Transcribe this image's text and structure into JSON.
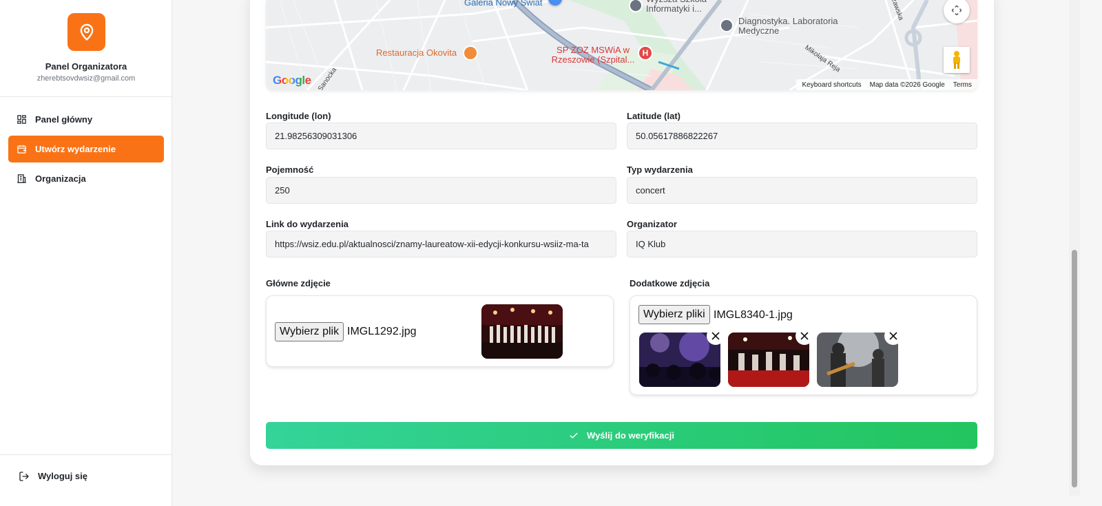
{
  "sidebar": {
    "title": "Panel Organizatora",
    "email": "zherebtsovdwsiz@gmail.com",
    "items": [
      {
        "label": "Panel główny"
      },
      {
        "label": "Utwórz wydarzenie"
      },
      {
        "label": "Organizacja"
      }
    ],
    "logout": "Wyloguj się",
    "accent": "#f97316"
  },
  "map": {
    "labels": {
      "galeria": "Galeria Nowy Świat",
      "szkola": "Wyższa Szkoła Informatyki i...",
      "diagnostyka": "Diagnostyka. Laboratoria Medyczne",
      "restauracja": "Restauracja Okovita",
      "szpital": "SP ZOZ MSWiA w Rzeszowie (Szpital...",
      "sanocka": "Sanocka",
      "mikolaja": "Mikołaja Reja",
      "zawska": "zawska"
    },
    "footer": {
      "shortcuts": "Keyboard shortcuts",
      "map_data": "Map data ©2026 Google",
      "terms": "Terms"
    },
    "logo": "Google"
  },
  "form": {
    "longitude": {
      "label": "Longitude (lon)",
      "value": "21.98256309031306"
    },
    "latitude": {
      "label": "Latitude (lat)",
      "value": "50.05617886822267"
    },
    "capacity": {
      "label": "Pojemność",
      "value": "250"
    },
    "event_type": {
      "label": "Typ wydarzenia",
      "value": "concert"
    },
    "event_link": {
      "label": "Link do wydarzenia",
      "value": "https://wsiz.edu.pl/aktualnosci/znamy-laureatow-xii-edycji-konkursu-wsiiz-ma-ta"
    },
    "organizer": {
      "label": "Organizator",
      "value": "IQ Klub"
    }
  },
  "main_photo": {
    "label": "Główne zdjęcie",
    "button": "Wybierz plik",
    "file": "IMGL1292.jpg"
  },
  "extra_photos": {
    "label": "Dodatkowe zdjęcia",
    "button": "Wybierz pliki",
    "file": "IMGL8340-1.jpg"
  },
  "submit": {
    "label": "Wyślij do weryfikacji",
    "color_start": "#34d399",
    "color_end": "#22c55e"
  }
}
